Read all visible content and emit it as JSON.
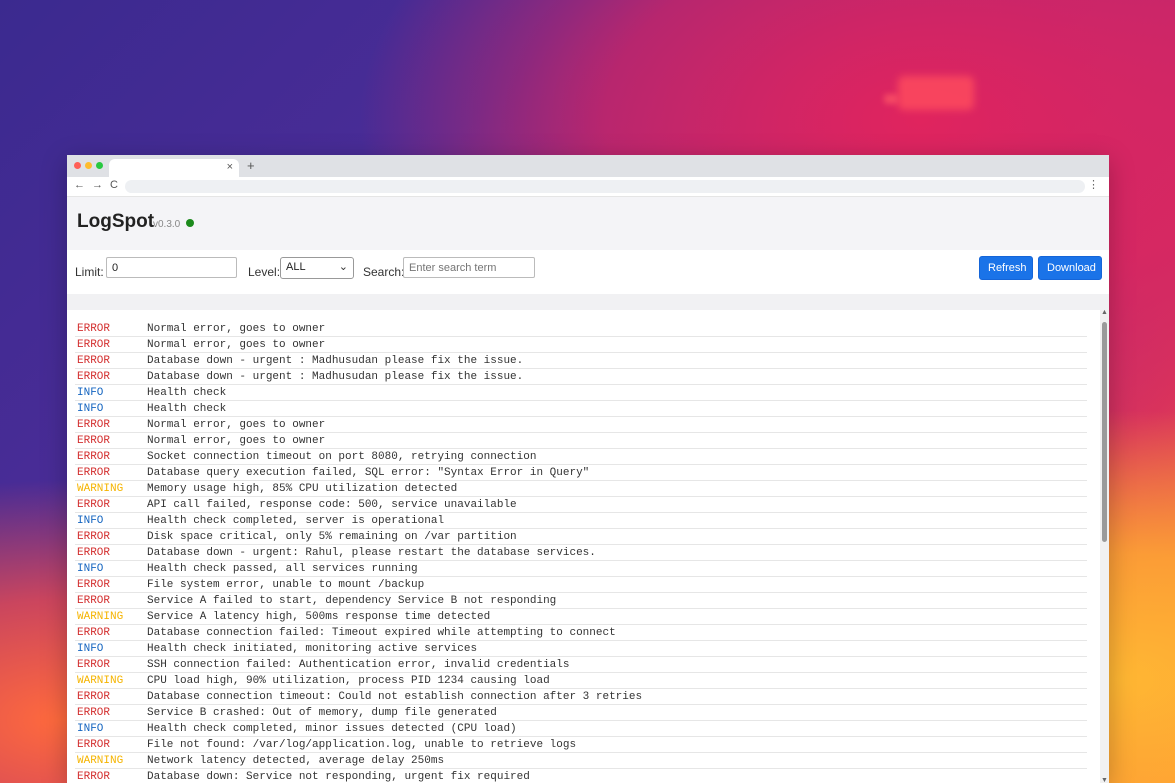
{
  "app": {
    "title": "LogSpot",
    "version": "v0.3.0",
    "status_color": "#1c8a1c"
  },
  "browser": {
    "tab_close": "×",
    "new_tab": "+",
    "back": "←",
    "forward": "→",
    "reload": "C",
    "menu": "⋮"
  },
  "controls": {
    "limit_label": "Limit:",
    "limit_value": "0",
    "level_label": "Level:",
    "level_value": "ALL",
    "search_label": "Search:",
    "search_placeholder": "Enter search term",
    "refresh_label": "Refresh",
    "download_label": "Download"
  },
  "colors": {
    "error": "#d32f2f",
    "info": "#1565c0",
    "warning": "#f5b400",
    "accent": "#1a73e8"
  },
  "logs": [
    {
      "level": "ERROR",
      "message": "Normal error, goes to owner"
    },
    {
      "level": "ERROR",
      "message": "Normal error, goes to owner"
    },
    {
      "level": "ERROR",
      "message": "Database down - urgent : Madhusudan please fix the issue."
    },
    {
      "level": "ERROR",
      "message": "Database down - urgent : Madhusudan please fix the issue."
    },
    {
      "level": "INFO",
      "message": "Health check"
    },
    {
      "level": "INFO",
      "message": "Health check"
    },
    {
      "level": "ERROR",
      "message": "Normal error, goes to owner"
    },
    {
      "level": "ERROR",
      "message": "Normal error, goes to owner"
    },
    {
      "level": "ERROR",
      "message": "Socket connection timeout on port 8080, retrying connection"
    },
    {
      "level": "ERROR",
      "message": "Database query execution failed, SQL error: \"Syntax Error in Query\""
    },
    {
      "level": "WARNING",
      "message": "Memory usage high, 85% CPU utilization detected"
    },
    {
      "level": "ERROR",
      "message": "API call failed, response code: 500, service unavailable"
    },
    {
      "level": "INFO",
      "message": "Health check completed, server is operational"
    },
    {
      "level": "ERROR",
      "message": "Disk space critical, only 5% remaining on /var partition"
    },
    {
      "level": "ERROR",
      "message": "Database down - urgent: Rahul, please restart the database services."
    },
    {
      "level": "INFO",
      "message": "Health check passed, all services running"
    },
    {
      "level": "ERROR",
      "message": "File system error, unable to mount /backup"
    },
    {
      "level": "ERROR",
      "message": "Service A failed to start, dependency Service B not responding"
    },
    {
      "level": "WARNING",
      "message": "Service A latency high, 500ms response time detected"
    },
    {
      "level": "ERROR",
      "message": "Database connection failed: Timeout expired while attempting to connect"
    },
    {
      "level": "INFO",
      "message": "Health check initiated, monitoring active services"
    },
    {
      "level": "ERROR",
      "message": "SSH connection failed: Authentication error, invalid credentials"
    },
    {
      "level": "WARNING",
      "message": "CPU load high, 90% utilization, process PID 1234 causing load"
    },
    {
      "level": "ERROR",
      "message": "Database connection timeout: Could not establish connection after 3 retries"
    },
    {
      "level": "ERROR",
      "message": "Service B crashed: Out of memory, dump file generated"
    },
    {
      "level": "INFO",
      "message": "Health check completed, minor issues detected (CPU load)"
    },
    {
      "level": "ERROR",
      "message": "File not found: /var/log/application.log, unable to retrieve logs"
    },
    {
      "level": "WARNING",
      "message": "Network latency detected, average delay 250ms"
    },
    {
      "level": "ERROR",
      "message": "Database down: Service not responding, urgent fix required"
    }
  ]
}
